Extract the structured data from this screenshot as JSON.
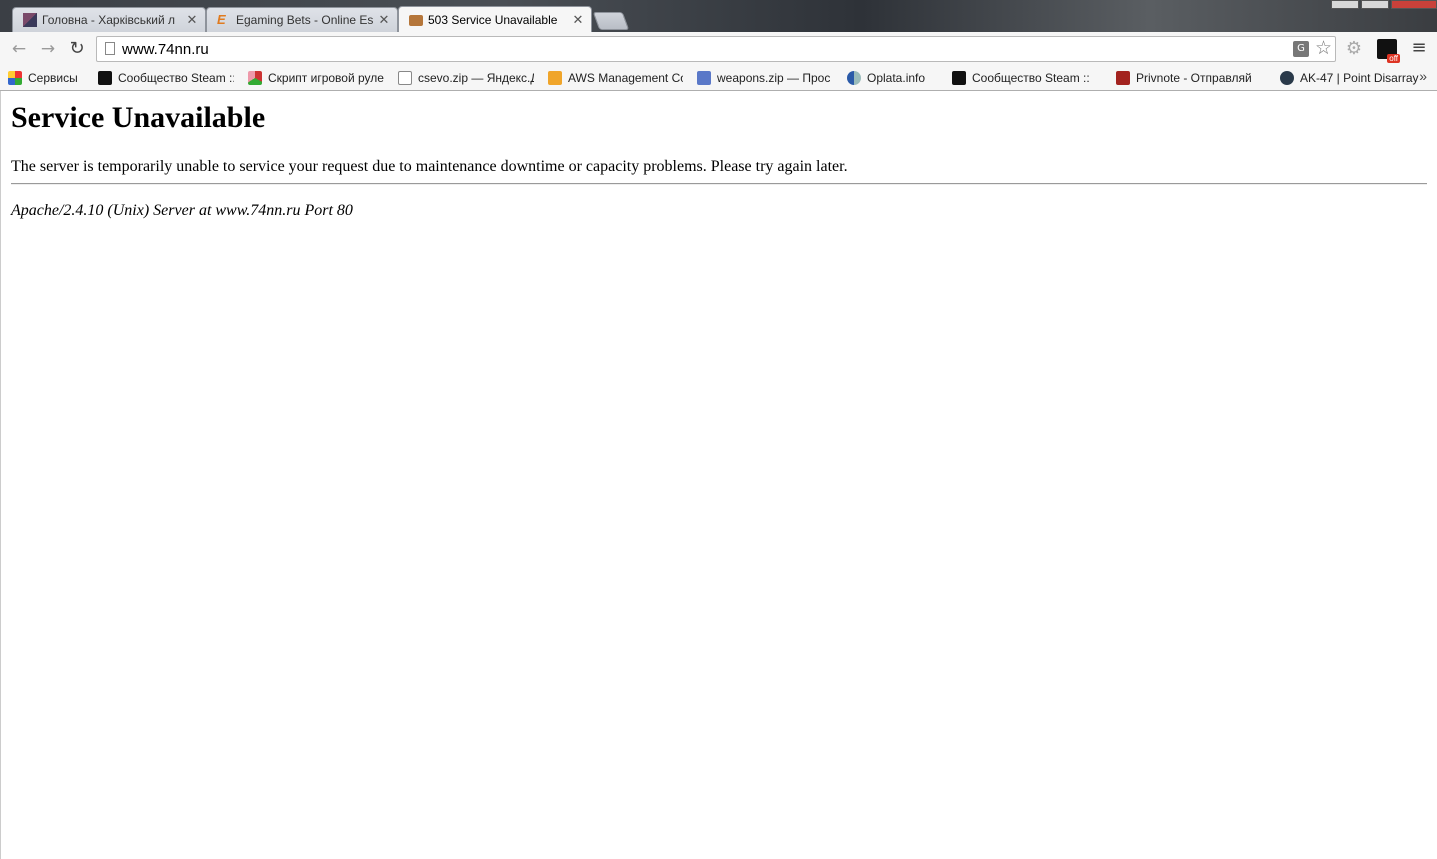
{
  "tabs": [
    {
      "label": "Головна - Харківський л",
      "active": false
    },
    {
      "label": "Egaming Bets - Online Esp",
      "active": false
    },
    {
      "label": "503 Service Unavailable",
      "active": true
    }
  ],
  "tab_close_glyph": "✕",
  "omnibox": {
    "url": "www.74nn.ru"
  },
  "extensions": {
    "off_badge": "off"
  },
  "bookmarks": [
    {
      "label": "Сервисы",
      "icon": "apps-grid-icon"
    },
    {
      "label": "Сообщество Steam ::",
      "icon": "steam-icon"
    },
    {
      "label": "Скрипт игровой руле",
      "icon": "roulette-icon"
    },
    {
      "label": "csevo.zip — Яндекс.Д",
      "icon": "yandex-disk-icon"
    },
    {
      "label": "AWS Management Co",
      "icon": "aws-cube-icon"
    },
    {
      "label": "weapons.zip — Прос",
      "icon": "document-icon"
    },
    {
      "label": "Oplata.info",
      "icon": "oplata-icon"
    },
    {
      "label": "Сообщество Steam ::",
      "icon": "steam-icon"
    },
    {
      "label": "Privnote - Отправляй",
      "icon": "privnote-icon"
    },
    {
      "label": "AK-47 | Point Disarray",
      "icon": "csgo-icon"
    }
  ],
  "bookmarks_overflow": "»",
  "page": {
    "heading": "Service Unavailable",
    "message": "The server is temporarily unable to service your request due to maintenance downtime or capacity problems. Please try again later.",
    "signature": "Apache/2.4.10 (Unix) Server at www.74nn.ru Port 80"
  }
}
